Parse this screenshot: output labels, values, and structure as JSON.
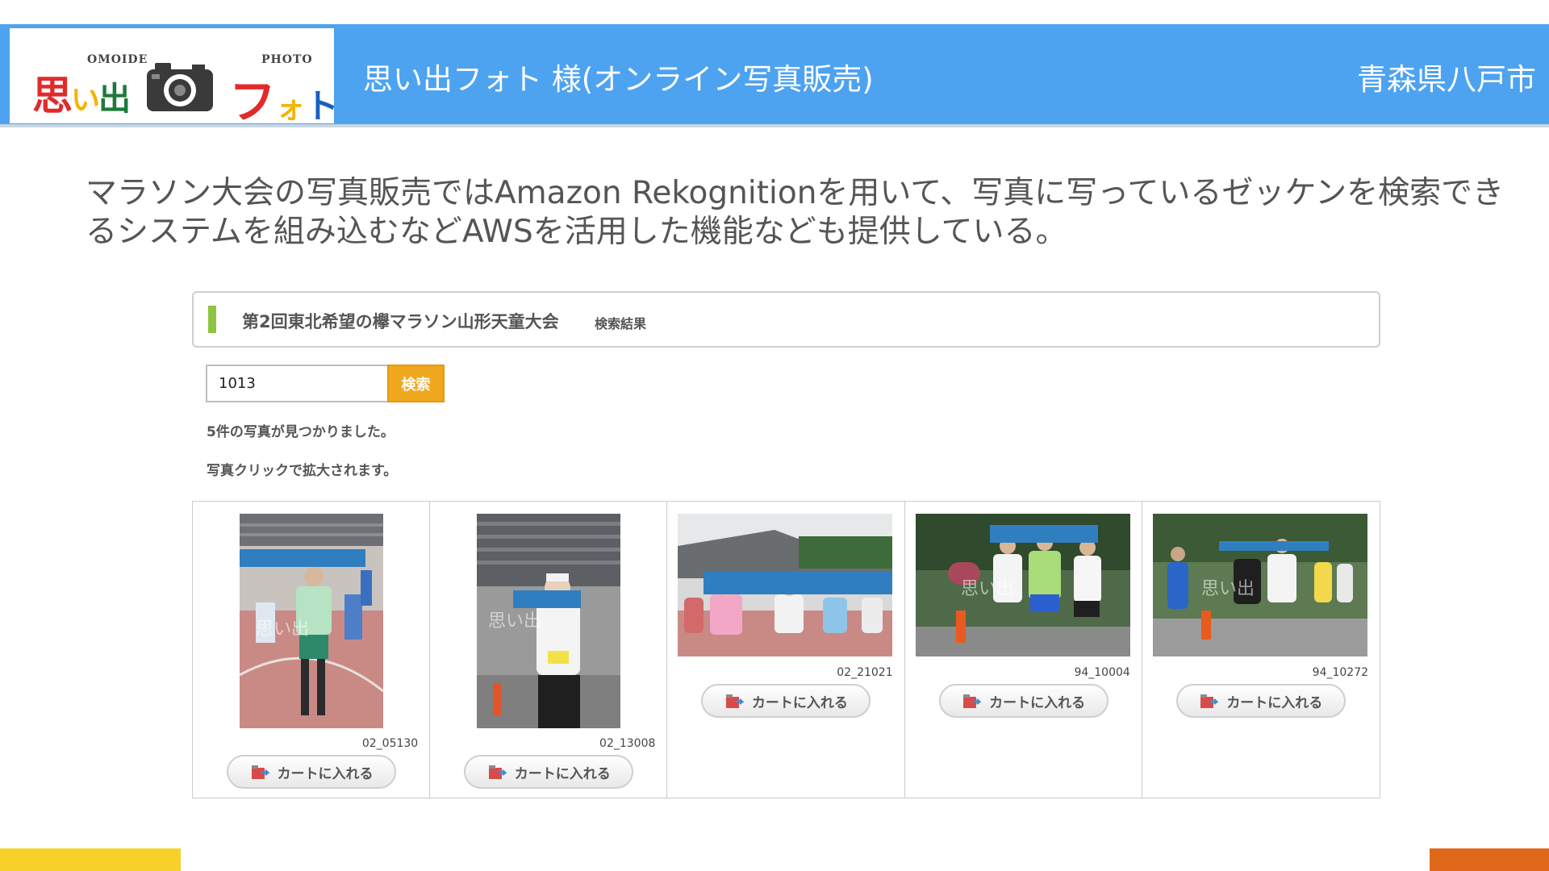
{
  "header": {
    "logo": {
      "omoide_text": "OMOIDE",
      "photo_text": "PHOTO",
      "chars": [
        "思",
        "い",
        "出"
      ],
      "fo_chars": [
        "フ",
        "ォ",
        "ト"
      ]
    },
    "title": "思い出フォト 様(オンライン写真販売)",
    "region": "青森県八戸市",
    "background": "#4da3f0"
  },
  "description": "マラソン大会の写真販売ではAmazon Rekognitionを用いて、写真に写っているゼッケンを検索できるシステムを組み込むなどAWSを活用した機能なども提供している。",
  "result_panel": {
    "event_name": "第2回東北希望の欅マラソン山形天童大会",
    "event_sub": "検索結果",
    "accent": "#8cc63f"
  },
  "search": {
    "value": "1013",
    "button_label": "検索"
  },
  "count_text": "5件の写真が見つかりました。",
  "hint_text": "写真クリックで拡大されます。",
  "photos": [
    {
      "id": "02_05130",
      "orientation": "portrait",
      "cart_label": "カートに入れる"
    },
    {
      "id": "02_13008",
      "orientation": "portrait",
      "cart_label": "カートに入れる"
    },
    {
      "id": "02_21021",
      "orientation": "landscape",
      "cart_label": "カートに入れる"
    },
    {
      "id": "94_10004",
      "orientation": "landscape",
      "cart_label": "カートに入れる"
    },
    {
      "id": "94_10272",
      "orientation": "landscape",
      "cart_label": "カートに入れる"
    }
  ],
  "colors": {
    "search_button": "#f0a81e",
    "deco_left": "#f7d12a",
    "deco_right": "#e0681b",
    "redaction": "#2f7fc0"
  }
}
